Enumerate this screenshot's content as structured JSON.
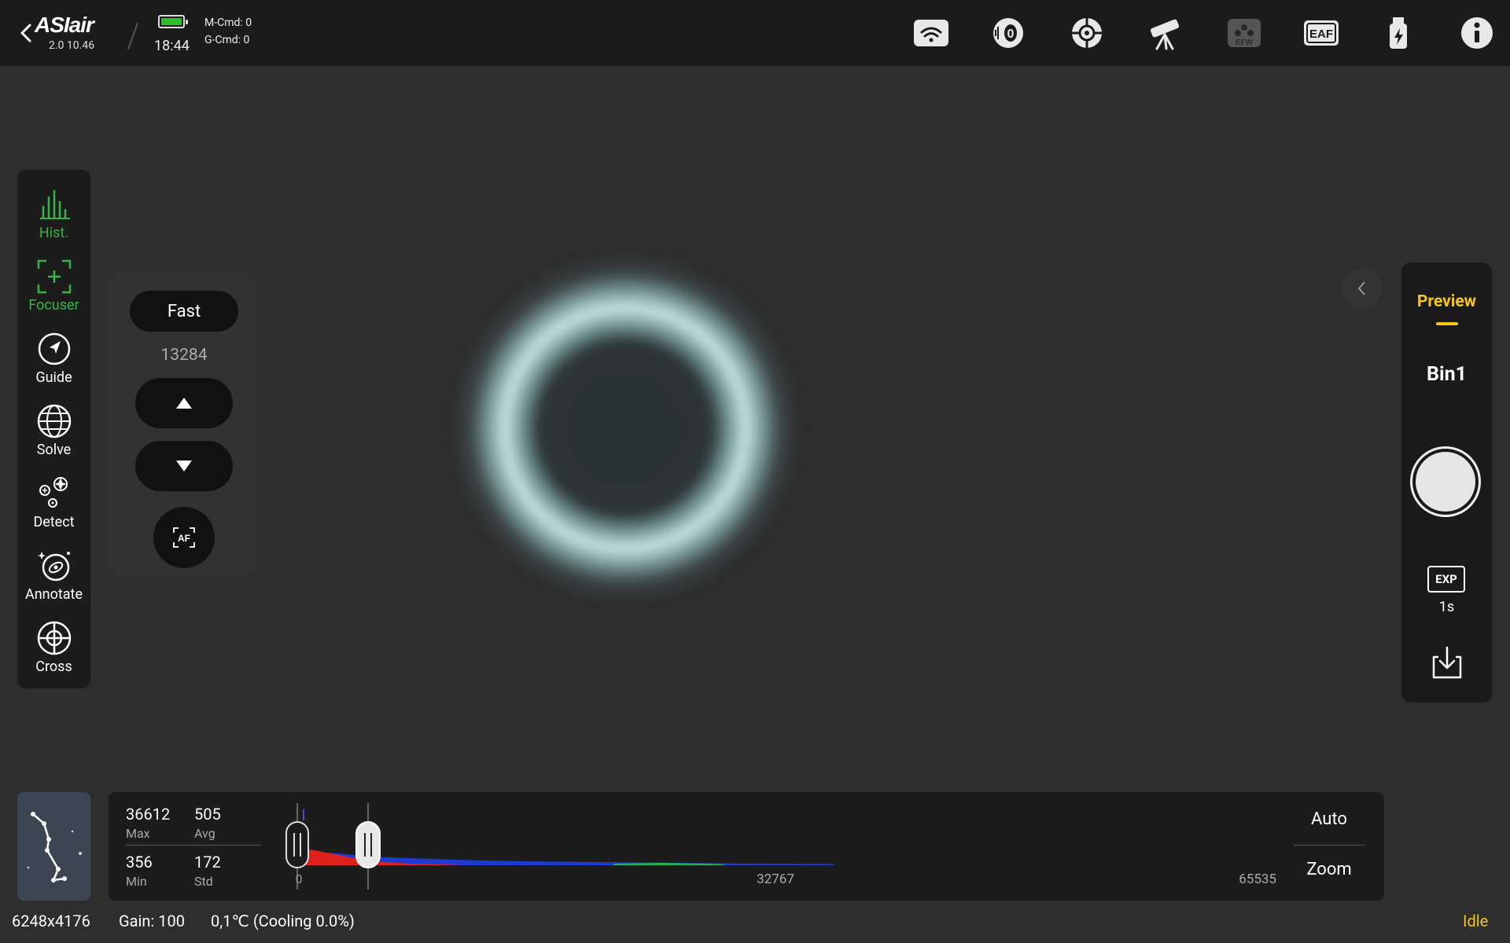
{
  "header": {
    "logo": "ASIair",
    "version": "2.0 10.46",
    "time": "18:44",
    "m_cmd": "M-Cmd: 0",
    "g_cmd": "G-Cmd: 0",
    "icons": [
      "wifi-icon",
      "camera-icon",
      "guide-camera-icon",
      "telescope-icon",
      "efw-icon",
      "eaf-icon",
      "usb-power-icon",
      "info-icon"
    ],
    "eaf_label": "EAF",
    "efw_label": "EFW",
    "camera_label": "0"
  },
  "tools": [
    {
      "label": "Hist.",
      "icon": "histogram-icon",
      "active": true
    },
    {
      "label": "Focuser",
      "icon": "focuser-icon",
      "active": true
    },
    {
      "label": "Guide",
      "icon": "guide-icon",
      "active": false
    },
    {
      "label": "Solve",
      "icon": "globe-icon",
      "active": false
    },
    {
      "label": "Detect",
      "icon": "detect-icon",
      "active": false
    },
    {
      "label": "Annotate",
      "icon": "annotate-icon",
      "active": false
    },
    {
      "label": "Cross",
      "icon": "crosshair-icon",
      "active": false
    }
  ],
  "focuser": {
    "speed": "Fast",
    "position": "13284",
    "af_label": "AF"
  },
  "right_panel": {
    "mode": "Preview",
    "bin": "Bin1",
    "exp_label": "EXP",
    "exposure": "1s"
  },
  "histogram": {
    "max_value": "36612",
    "max_label": "Max",
    "avg_value": "505",
    "avg_label": "Avg",
    "min_value": "356",
    "min_label": "Min",
    "std_value": "172",
    "std_label": "Std",
    "axis_start": "0",
    "axis_mid": "32767",
    "axis_end": "65535",
    "auto_label": "Auto",
    "zoom_label": "Zoom"
  },
  "status": {
    "resolution": "6248x4176",
    "gain": "Gain: 100",
    "temperature": "0,1℃ (Cooling 0.0%)",
    "state": "Idle"
  },
  "colors": {
    "accent_green": "#37b34a",
    "accent_yellow": "#f5c518",
    "panel": "#1c1c1c",
    "background": "#2e2e2e"
  }
}
